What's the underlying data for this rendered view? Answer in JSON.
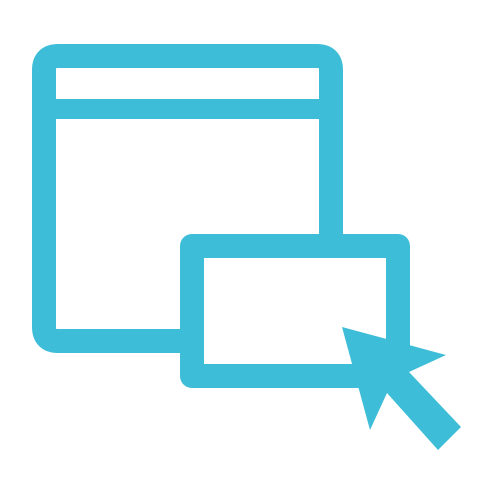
{
  "icon": {
    "name": "window-popup-cursor-icon",
    "stroke_color": "#3dbdd8",
    "background_color": "#ffffff",
    "parts": [
      "browser-window",
      "popup-window",
      "mouse-cursor"
    ]
  }
}
